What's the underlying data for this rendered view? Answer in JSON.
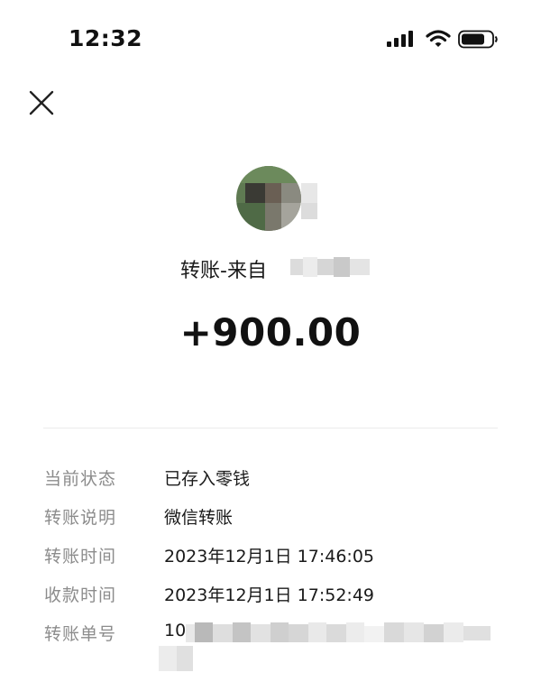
{
  "status_bar": {
    "time": "12:32",
    "icons": [
      "signal-icon",
      "wifi-icon",
      "battery-icon"
    ]
  },
  "header": {
    "close_icon": "close-icon"
  },
  "sender": {
    "label": "转账-来自"
  },
  "amount": "+900.00",
  "details": [
    {
      "label": "当前状态",
      "value": "已存入零钱"
    },
    {
      "label": "转账说明",
      "value": "微信转账"
    },
    {
      "label": "转账时间",
      "value": "2023年12月1日 17:46:05"
    },
    {
      "label": "收款时间",
      "value": "2023年12月1日 17:52:49"
    },
    {
      "label": "转账单号",
      "value": "10"
    }
  ],
  "colors": {
    "label": "#8c8c8c",
    "text": "#1a1a1a",
    "divider": "#ececec"
  }
}
